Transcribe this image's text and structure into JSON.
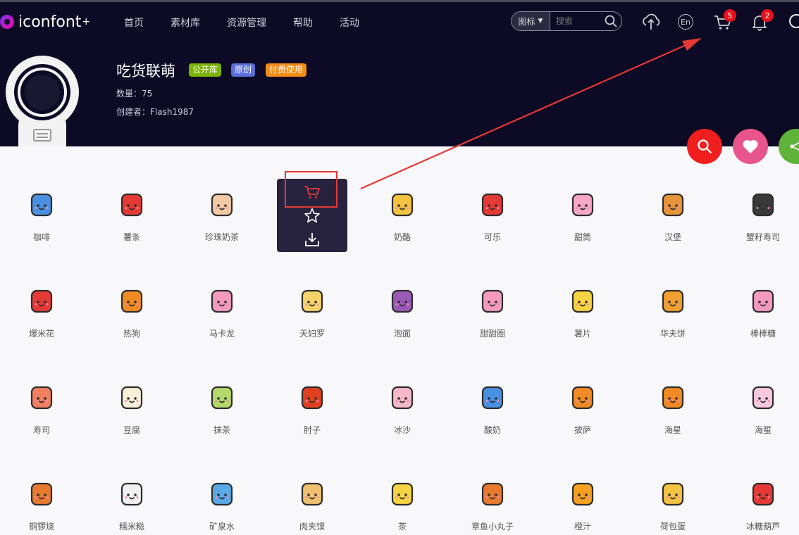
{
  "header": {
    "logo_text": "iconfont",
    "logo_plus": "+",
    "nav": [
      "首页",
      "素材库",
      "资源管理",
      "帮助",
      "活动"
    ],
    "search": {
      "type_label": "图标",
      "placeholder": "搜索"
    },
    "lang_label": "En",
    "cart_count": "5",
    "notify_count": "2"
  },
  "project": {
    "title": "吃货联萌",
    "tags": [
      {
        "label": "公开库",
        "color": "#7cb305"
      },
      {
        "label": "原创",
        "color": "#5a6fd8"
      },
      {
        "label": "付费使用",
        "color": "#f28c18"
      }
    ],
    "count_line": "数量：75",
    "creator_line": "创建者：Flash1987"
  },
  "icons": [
    {
      "label": "咖啡",
      "icon": "coffee-cup-icon",
      "color": "#4a90e2"
    },
    {
      "label": "薯条",
      "icon": "fries-icon",
      "color": "#e53935"
    },
    {
      "label": "珍珠奶茶",
      "icon": "bubble-tea-icon",
      "color": "#f3c9a5"
    },
    {
      "label": "",
      "icon": "hover-actions",
      "color": "#27233e"
    },
    {
      "label": "奶酪",
      "icon": "cheese-icon",
      "color": "#f5c342"
    },
    {
      "label": "可乐",
      "icon": "cola-icon",
      "color": "#e53935"
    },
    {
      "label": "甜筒",
      "icon": "ice-cream-cone-icon",
      "color": "#f7a8c4"
    },
    {
      "label": "汉堡",
      "icon": "burger-icon",
      "color": "#e8953a"
    },
    {
      "label": "蟹籽寿司",
      "icon": "roe-sushi-icon",
      "color": "#3a3a3a"
    },
    {
      "label": "爆米花",
      "icon": "popcorn-icon",
      "color": "#e53935"
    },
    {
      "label": "热狗",
      "icon": "corn-dog-icon",
      "color": "#f08a24"
    },
    {
      "label": "马卡龙",
      "icon": "macaron-icon",
      "color": "#f49ac1"
    },
    {
      "label": "天妇罗",
      "icon": "tempura-icon",
      "color": "#f5d36b"
    },
    {
      "label": "泡面",
      "icon": "instant-noodles-icon",
      "color": "#9b59b6"
    },
    {
      "label": "甜甜圈",
      "icon": "donut-icon",
      "color": "#f49ac1"
    },
    {
      "label": "薯片",
      "icon": "chips-icon",
      "color": "#f5d342"
    },
    {
      "label": "华夫饼",
      "icon": "waffle-icon",
      "color": "#f0a030"
    },
    {
      "label": "棒棒糖",
      "icon": "lollipop-icon",
      "color": "#f49ac1"
    },
    {
      "label": "寿司",
      "icon": "sushi-icon",
      "color": "#f08060"
    },
    {
      "label": "豆腐",
      "icon": "tofu-icon",
      "color": "#f7efd8"
    },
    {
      "label": "抹茶",
      "icon": "matcha-icon",
      "color": "#b5d86a"
    },
    {
      "label": "肘子",
      "icon": "pork-knuckle-icon",
      "color": "#e04020"
    },
    {
      "label": "冰沙",
      "icon": "smoothie-icon",
      "color": "#f7b8c8"
    },
    {
      "label": "酸奶",
      "icon": "yogurt-icon",
      "color": "#4a90e2"
    },
    {
      "label": "披萨",
      "icon": "pizza-icon",
      "color": "#f08a24"
    },
    {
      "label": "海星",
      "icon": "starfish-icon",
      "color": "#f08a24"
    },
    {
      "label": "海蜇",
      "icon": "jellyfish-icon",
      "color": "#f7c8e0"
    },
    {
      "label": "铜锣烧",
      "icon": "dorayaki-icon",
      "color": "#e87a30"
    },
    {
      "label": "糯米糍",
      "icon": "mochi-icon",
      "color": "#f0f0f0"
    },
    {
      "label": "矿泉水",
      "icon": "water-bottle-icon",
      "color": "#5aa8e6"
    },
    {
      "label": "肉夹馍",
      "icon": "roujiamo-icon",
      "color": "#f0c070"
    },
    {
      "label": "茶",
      "icon": "tea-cup-icon",
      "color": "#f5d342"
    },
    {
      "label": "章鱼小丸子",
      "icon": "takoyaki-icon",
      "color": "#e87a30"
    },
    {
      "label": "橙汁",
      "icon": "orange-juice-icon",
      "color": "#f5a020"
    },
    {
      "label": "荷包蛋",
      "icon": "fried-egg-icon",
      "color": "#f5c342"
    },
    {
      "label": "冰糖葫芦",
      "icon": "tanghulu-icon",
      "color": "#e53935"
    }
  ]
}
